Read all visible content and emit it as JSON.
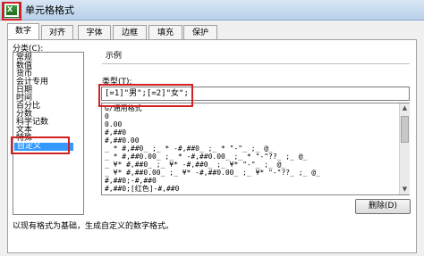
{
  "window": {
    "title": "单元格格式"
  },
  "tabs": [
    {
      "label": "数字",
      "active": true
    },
    {
      "label": "对齐"
    },
    {
      "label": "字体"
    },
    {
      "label": "边框"
    },
    {
      "label": "填充"
    },
    {
      "label": "保护"
    }
  ],
  "category": {
    "label": "分类(C):",
    "items": [
      "常规",
      "数值",
      "货币",
      "会计专用",
      "日期",
      "时间",
      "百分比",
      "分数",
      "科学记数",
      "文本",
      "特殊",
      "自定义"
    ],
    "selected": "自定义"
  },
  "sample": {
    "label": "示例"
  },
  "type": {
    "label": "类型(T):",
    "value": "[=1]\"男\";[=2]\"女\";"
  },
  "formats": [
    "G/通用格式",
    "0",
    "0.00",
    "#,##0",
    "#,##0.00",
    "_ * #,##0_ ;_ * -#,##0_ ;_ * \"-\"_ ;_ @_",
    "_ * #,##0.00_ ;_ * -#,##0.00_ ;_ * \"-\"??_ ;_ @_",
    "_ ¥* #,##0_ ;_ ¥* -#,##0_ ;_ ¥* \"-\"_ ;_ @_",
    "_ ¥* #,##0.00_ ;_ ¥* -#,##0.00_ ;_ ¥* \"-\"??_ ;_ @_",
    "#,##0;-#,##0",
    "#,##0;[红色]-#,##0"
  ],
  "buttons": {
    "delete": "删除(D)"
  },
  "hint": "以现有格式为基础，生成自定义的数字格式。",
  "colors": {
    "highlight": "#d32020",
    "selection": "#3399ff"
  }
}
